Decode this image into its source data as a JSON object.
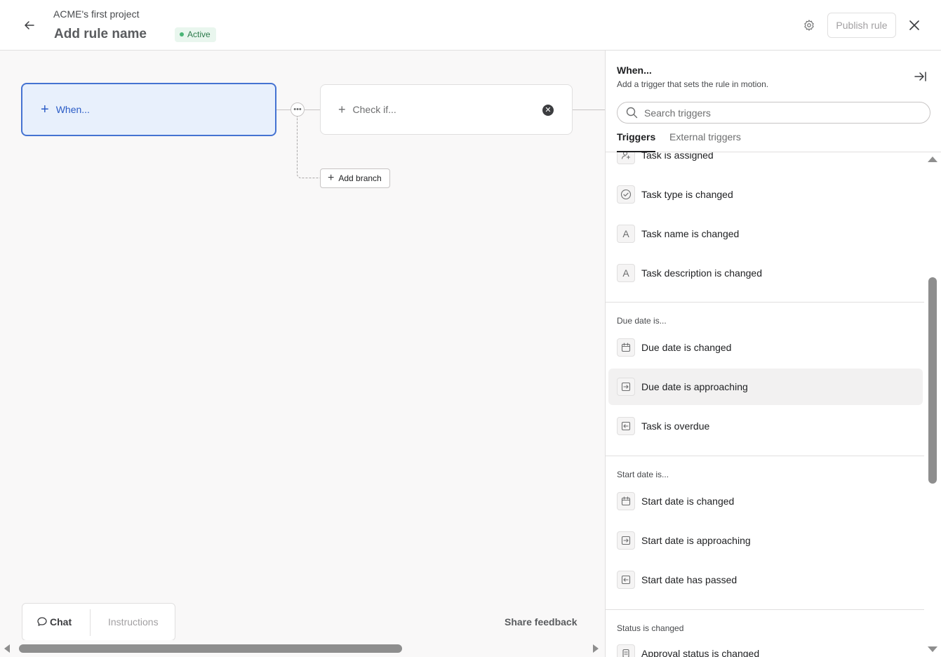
{
  "header": {
    "project_name": "ACME's first project",
    "rule_name": "Add rule name",
    "status_badge": "Active",
    "publish_label": "Publish rule"
  },
  "canvas": {
    "when_label": "When...",
    "check_label": "Check if...",
    "add_branch_label": "Add branch",
    "chat_label": "Chat",
    "instructions_label": "Instructions",
    "share_feedback_label": "Share feedback"
  },
  "panel": {
    "title": "When...",
    "subtitle": "Add a trigger that sets the rule in motion.",
    "search_placeholder": "Search triggers",
    "tabs": [
      {
        "label": "Triggers",
        "active": true
      },
      {
        "label": "External triggers",
        "active": false
      }
    ],
    "task_items": [
      {
        "label": "Task is assigned",
        "icon": "person-add-icon"
      },
      {
        "label": "Task type is changed",
        "icon": "check-circle-icon"
      },
      {
        "label": "Task name is changed",
        "icon": "text-icon"
      },
      {
        "label": "Task description is changed",
        "icon": "text-icon"
      }
    ],
    "due_date_section": {
      "heading": "Due date is...",
      "items": [
        {
          "label": "Due date is changed",
          "icon": "calendar-icon"
        },
        {
          "label": "Due date is approaching",
          "icon": "arrow-in-icon"
        },
        {
          "label": "Task is overdue",
          "icon": "arrow-out-icon"
        }
      ]
    },
    "start_date_section": {
      "heading": "Start date is...",
      "items": [
        {
          "label": "Start date is changed",
          "icon": "calendar-icon"
        },
        {
          "label": "Start date is approaching",
          "icon": "arrow-in-icon"
        },
        {
          "label": "Start date has passed",
          "icon": "arrow-out-icon"
        }
      ]
    },
    "status_section": {
      "heading": "Status is changed",
      "items": [
        {
          "label": "Approval status is changed",
          "icon": "approval-icon"
        }
      ]
    }
  },
  "colors": {
    "accent": "#4573d2",
    "accent_bg": "#e8f0fc",
    "active_badge_bg": "#e9f6ee",
    "active_badge_text": "#2c7a4b"
  }
}
